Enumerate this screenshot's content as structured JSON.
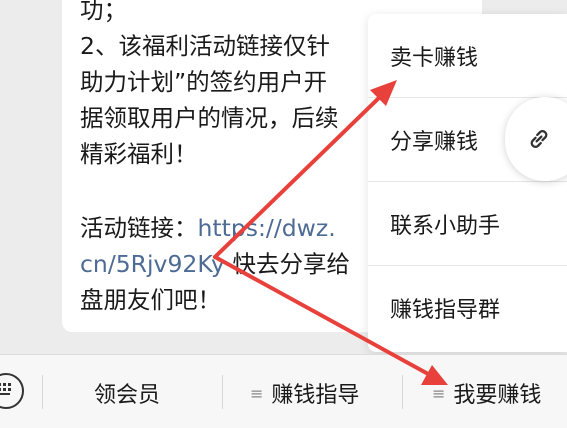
{
  "message": {
    "line1": "功；",
    "line2": "2、该福利活动链接仅针",
    "line3": "助力计划”的签约用户开",
    "line4": "据领取用户的情况，后续",
    "line5": "精彩福利！",
    "link_label": "活动链接：",
    "link_part1": "https://dwz.",
    "link_part2": "cn/5Rjv92Ky",
    "after_link": "快去分享给",
    "line_last": "盘朋友们吧！"
  },
  "menu": {
    "items": [
      {
        "label": "卖卡赚钱"
      },
      {
        "label": "分享赚钱"
      },
      {
        "label": "联系小助手"
      },
      {
        "label": "赚钱指导群"
      }
    ]
  },
  "share_button": {
    "icon": "link-icon"
  },
  "bottom_bar": {
    "keyboard_icon": "keyboard-icon",
    "tabs": [
      {
        "label": "领会员"
      },
      {
        "label": "赚钱指导",
        "prefix": "≡"
      },
      {
        "label": "我要赚钱",
        "prefix": "≡"
      }
    ]
  },
  "colors": {
    "arrow": "#e8403a",
    "link": "#4d6b94",
    "background": "#ececec"
  }
}
